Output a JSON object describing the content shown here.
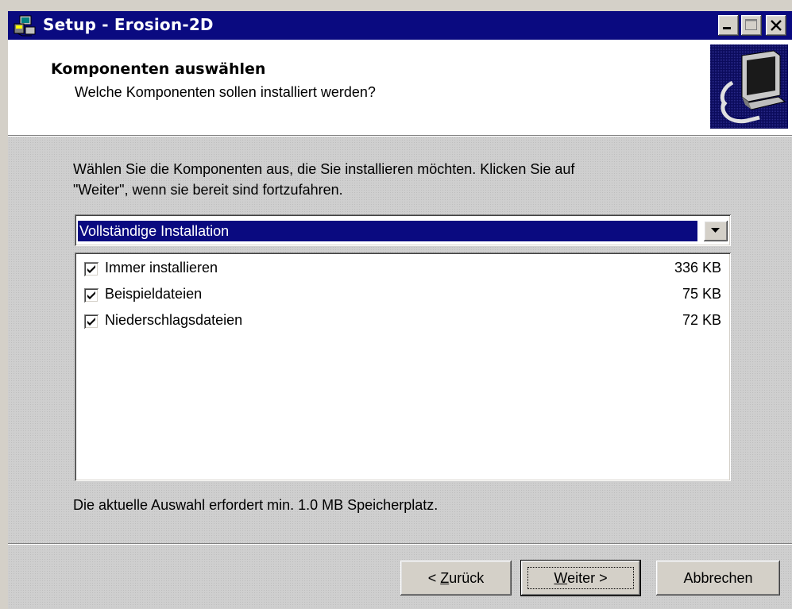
{
  "window": {
    "title": "Setup - Erosion-2D",
    "title_icon": "setup-installer-icon",
    "controls": [
      "minimize-icon",
      "maximize-icon",
      "close-icon"
    ]
  },
  "header": {
    "title": "Komponenten auswählen",
    "subtitle": "Welche Komponenten sollen installiert werden?",
    "image": "computer-install-icon"
  },
  "instructions": {
    "line1": "Wählen Sie die Komponenten aus, die Sie installieren möchten. Klicken Sie auf",
    "line2": "\"Weiter\", wenn sie bereit sind fortzufahren."
  },
  "install_type": {
    "selected": "Vollständige Installation"
  },
  "components": [
    {
      "label": "Immer installieren",
      "size": "336 KB",
      "checked": true
    },
    {
      "label": "Beispieldateien",
      "size": "75 KB",
      "checked": true
    },
    {
      "label": "Niederschlagsdateien",
      "size": "72 KB",
      "checked": true
    }
  ],
  "space_required": "Die aktuelle Auswahl erfordert min. 1.0 MB Speicherplatz.",
  "buttons": {
    "back_prefix": "< ",
    "back_accel": "Z",
    "back_rest": "urück",
    "next_accel": "W",
    "next_rest": "eiter >",
    "cancel": "Abbrechen"
  },
  "colors": {
    "title_bar": "#0a0a80",
    "selection": "#0a0a80",
    "face": "#d4d0c8"
  }
}
